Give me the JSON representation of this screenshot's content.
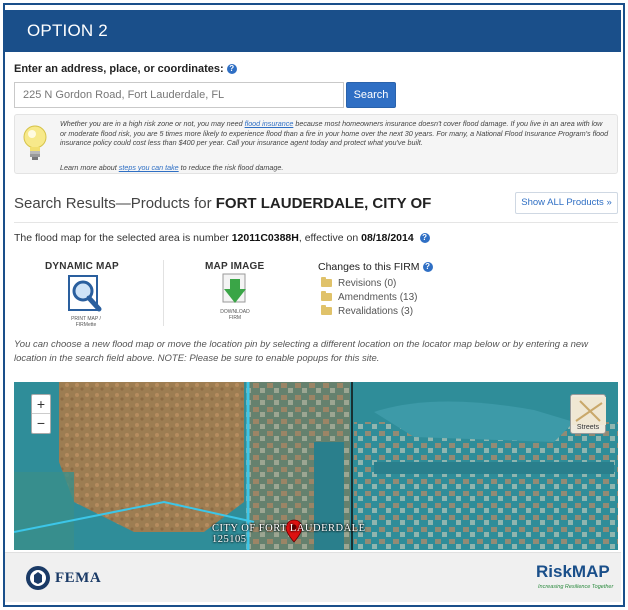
{
  "header": {
    "title": "OPTION 2"
  },
  "search": {
    "label": "Enter an address, place, or coordinates:",
    "value": "225 N Gordon Road, Fort Lauderdale, FL",
    "button_label": "Search"
  },
  "tip": {
    "text_before_link": "Whether you are in a high risk zone or not, you may need ",
    "link1": "flood insurance",
    "text_after_link": " because most homeowners insurance doesn't cover flood damage. If you live in an area with low or moderate flood risk, you are 5 times more likely to experience flood than a fire in your home over the next 30 years. For many, a National Flood Insurance Program's flood insurance policy could cost less than $400 per year. Call your insurance agent today and protect what you've built.",
    "learn_before": "Learn more about ",
    "link2": "steps you can take",
    "learn_after": " to reduce the risk flood damage."
  },
  "results": {
    "title_prefix": "Search Results—Products for ",
    "community": "FORT LAUDERDALE, CITY OF",
    "show_all_label": "Show ALL Products »",
    "firm_prefix": "The flood map for the selected area is number ",
    "firm_number": "12011C0388H",
    "effective_text": ", effective on ",
    "effective_date": "08/18/2014"
  },
  "products": {
    "dynamic_title": "DYNAMIC MAP",
    "dynamic_sub": "PRINT MAP / FIRMette",
    "image_title": "MAP IMAGE",
    "image_sub": "DOWNLOAD FIRM",
    "changes_title": "Changes to this FIRM",
    "changes": [
      {
        "label": "Revisions (0)"
      },
      {
        "label": "Amendments (13)"
      },
      {
        "label": "Revalidations (3)"
      }
    ]
  },
  "note": "You can choose a new flood map or move the location pin by selecting a different location on the locator map below or by entering a new location in the search field above. NOTE: Please be sure to enable popups for this site.",
  "map": {
    "zoom_in": "+",
    "zoom_out": "−",
    "streets_label": "Streets",
    "place_label": "CITY OF FORT LAUDERDALE",
    "place_sub": "125105",
    "colors": {
      "water_zone": "#2f8d99",
      "land_zone": "#b07a45",
      "boundary": "#3cc6e8"
    }
  },
  "footer": {
    "fema": "FEMA",
    "riskmap_risk": "Risk",
    "riskmap_map": "MAP",
    "riskmap_tag": "Increasing Resilience Together"
  }
}
